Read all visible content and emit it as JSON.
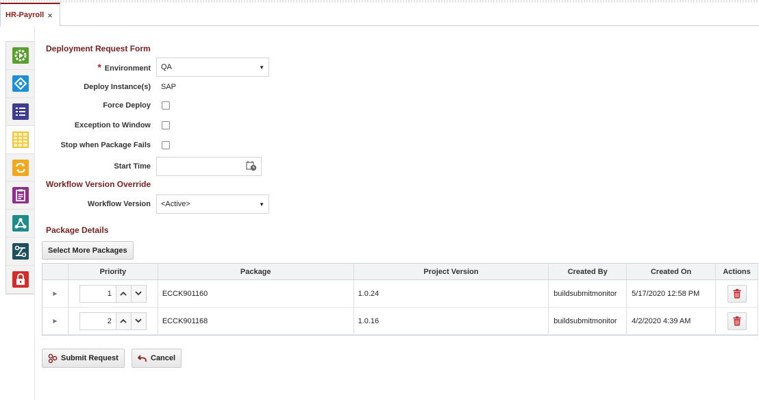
{
  "tab": {
    "title": "HR-Payroll",
    "close_glyph": "×"
  },
  "sidebar": {
    "items": [
      {
        "icon": "gear-play-icon",
        "color": "#5a9e2e"
      },
      {
        "icon": "network-diamond-icon",
        "color": "#1c8fd6"
      },
      {
        "icon": "list-icon",
        "color": "#3f3d8f"
      },
      {
        "icon": "grid-table-icon",
        "color": "#f2c232"
      },
      {
        "icon": "sync-icon",
        "color": "#f0a81e"
      },
      {
        "icon": "report-icon",
        "color": "#8e2f8a"
      },
      {
        "icon": "share-nodes-icon",
        "color": "#1f8b8b"
      },
      {
        "icon": "pipeline-icon",
        "color": "#1d4f5c"
      },
      {
        "icon": "lock-icon",
        "color": "#d62b2b"
      }
    ],
    "active_index": 3
  },
  "form": {
    "title": "Deployment Request Form",
    "required_mark": "*",
    "environment": {
      "label": "Environment",
      "value": "QA"
    },
    "deploy_instances": {
      "label": "Deploy Instance(s)",
      "value": "SAP"
    },
    "force_deploy": {
      "label": "Force Deploy",
      "checked": false
    },
    "exception_window": {
      "label": "Exception to Window",
      "checked": false
    },
    "stop_on_fail": {
      "label": "Stop when Package Fails",
      "checked": false
    },
    "start_time": {
      "label": "Start Time",
      "value": ""
    }
  },
  "workflow": {
    "title": "Workflow Version Override",
    "version": {
      "label": "Workflow Version",
      "value": "<Active>"
    }
  },
  "packages": {
    "title": "Package Details",
    "select_more_label": "Select More Packages",
    "columns": [
      "Priority",
      "Package",
      "Project Version",
      "Created By",
      "Created On",
      "Actions"
    ],
    "rows": [
      {
        "priority": "1",
        "package": "ECCK901160",
        "version": "1.0.24",
        "created_by": "buildsubmitmonitor",
        "created_on": "5/17/2020 12:58 PM"
      },
      {
        "priority": "2",
        "package": "ECCK901168",
        "version": "1.0.16",
        "created_by": "buildsubmitmonitor",
        "created_on": "4/2/2020 4:39 AM"
      }
    ]
  },
  "actions": {
    "submit_label": "Submit Request",
    "cancel_label": "Cancel"
  },
  "colors": {
    "accent": "#8b1a1a",
    "section": "#7a1f1f",
    "trash": "#c0282d"
  }
}
